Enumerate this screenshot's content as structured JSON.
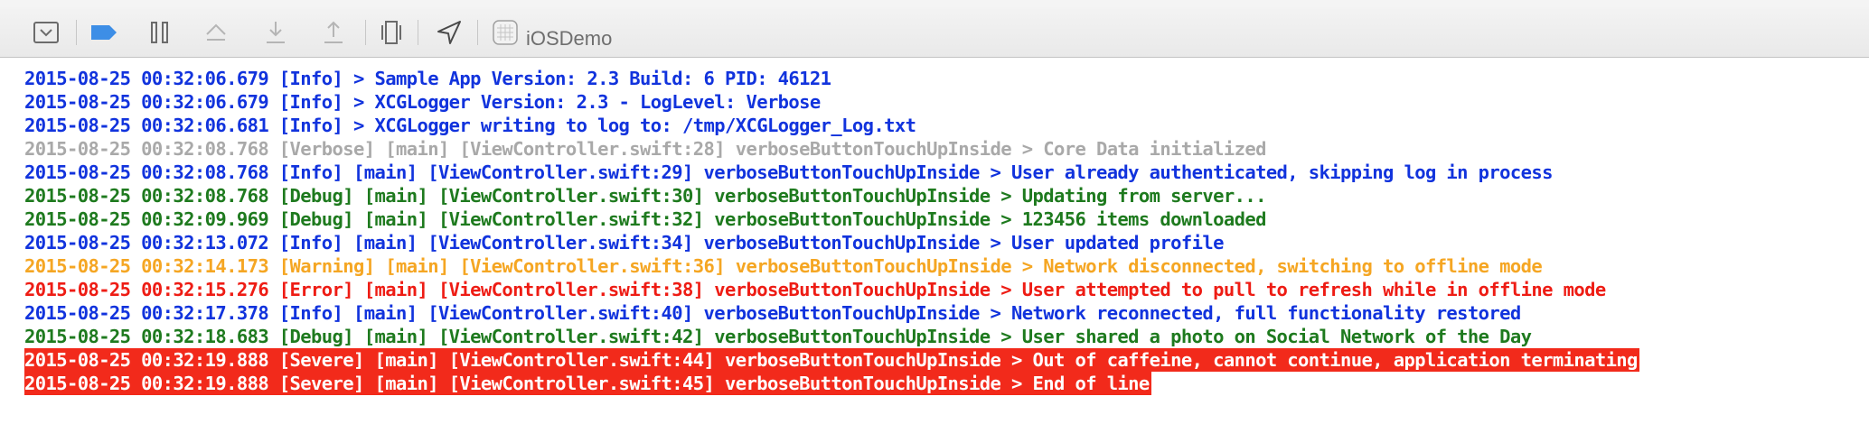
{
  "toolbar": {
    "buttons": [
      {
        "name": "hide-debug-area-icon"
      },
      {
        "name": "breakpoints-toggle-icon"
      },
      {
        "name": "pause-icon"
      },
      {
        "name": "step-over-icon"
      },
      {
        "name": "step-into-icon"
      },
      {
        "name": "step-out-icon"
      },
      {
        "name": "view-debugger-icon"
      },
      {
        "name": "simulate-location-icon"
      }
    ],
    "target_label": "iOSDemo"
  },
  "colors": {
    "info": "#1133dd",
    "verbose": "#a9a9a9",
    "debug": "#1e7a1e",
    "warning": "#f5a623",
    "error": "#ee1c14",
    "severe_bg": "#f22a1b",
    "severe_text": "#ffffff",
    "toolbar_icon": "#6b6b6b",
    "toolbar_accent": "#3d8ee6"
  },
  "console": {
    "lines": [
      {
        "level": "info",
        "text": "2015-08-25 00:32:06.679 [Info] > Sample App Version: 2.3 Build: 6 PID: 46121"
      },
      {
        "level": "info",
        "text": "2015-08-25 00:32:06.679 [Info] > XCGLogger Version: 2.3 - LogLevel: Verbose"
      },
      {
        "level": "info",
        "text": "2015-08-25 00:32:06.681 [Info] > XCGLogger writing to log to: /tmp/XCGLogger_Log.txt"
      },
      {
        "level": "verbose",
        "text": "2015-08-25 00:32:08.768 [Verbose] [main] [ViewController.swift:28] verboseButtonTouchUpInside > Core Data initialized"
      },
      {
        "level": "info",
        "text": "2015-08-25 00:32:08.768 [Info] [main] [ViewController.swift:29] verboseButtonTouchUpInside > User already authenticated, skipping log in process"
      },
      {
        "level": "debug",
        "text": "2015-08-25 00:32:08.768 [Debug] [main] [ViewController.swift:30] verboseButtonTouchUpInside > Updating from server..."
      },
      {
        "level": "debug",
        "text": "2015-08-25 00:32:09.969 [Debug] [main] [ViewController.swift:32] verboseButtonTouchUpInside > 123456 items downloaded"
      },
      {
        "level": "info",
        "text": "2015-08-25 00:32:13.072 [Info] [main] [ViewController.swift:34] verboseButtonTouchUpInside > User updated profile"
      },
      {
        "level": "warning",
        "text": "2015-08-25 00:32:14.173 [Warning] [main] [ViewController.swift:36] verboseButtonTouchUpInside > Network disconnected, switching to offline mode"
      },
      {
        "level": "error",
        "text": "2015-08-25 00:32:15.276 [Error] [main] [ViewController.swift:38] verboseButtonTouchUpInside > User attempted to pull to refresh while in offline mode"
      },
      {
        "level": "info",
        "text": "2015-08-25 00:32:17.378 [Info] [main] [ViewController.swift:40] verboseButtonTouchUpInside > Network reconnected, full functionality restored"
      },
      {
        "level": "debug",
        "text": "2015-08-25 00:32:18.683 [Debug] [main] [ViewController.swift:42] verboseButtonTouchUpInside > User shared a photo on Social Network of the Day"
      },
      {
        "level": "severe",
        "text": "2015-08-25 00:32:19.888 [Severe] [main] [ViewController.swift:44] verboseButtonTouchUpInside > Out of caffeine, cannot continue, application terminating"
      },
      {
        "level": "severe",
        "text": "2015-08-25 00:32:19.888 [Severe] [main] [ViewController.swift:45] verboseButtonTouchUpInside > End of line"
      }
    ]
  }
}
